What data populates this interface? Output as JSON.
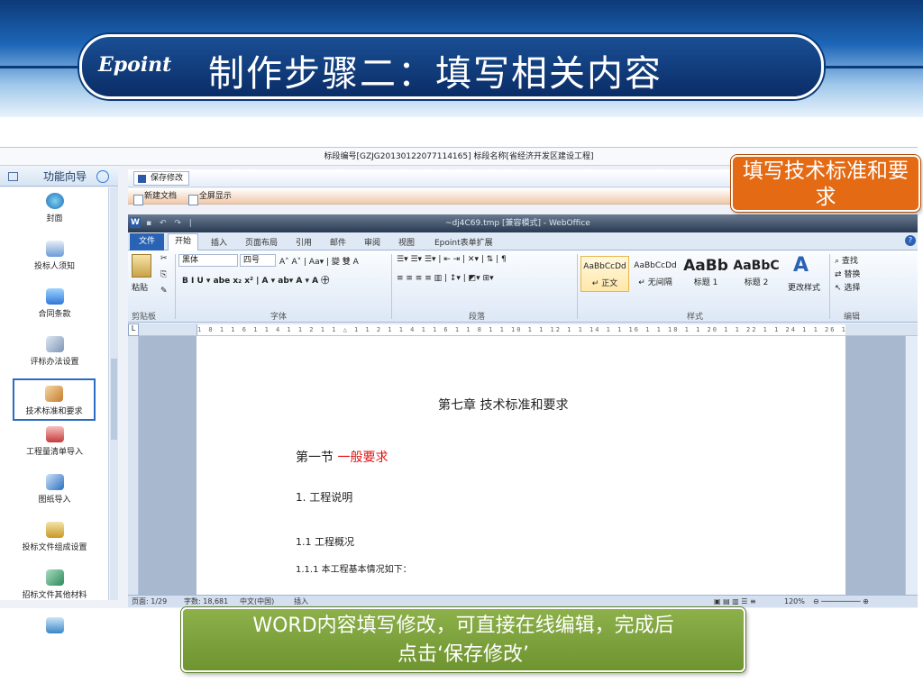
{
  "slide": {
    "logo": "Epoint",
    "title": "制作步骤二：填写相关内容"
  },
  "info_bar": "标段编号[GZJG20130122077114165]  标段名称[省经济开发区建设工程]",
  "sidebar": {
    "title": "功能向导",
    "items": [
      {
        "label": "封面",
        "icon": "globe-icon"
      },
      {
        "label": "投标人须知",
        "icon": "user-doc-icon"
      },
      {
        "label": "合同条款",
        "icon": "contract-icon"
      },
      {
        "label": "评标办法设置",
        "icon": "pen-icon"
      },
      {
        "label": "技术标准和要求",
        "icon": "tools-icon"
      },
      {
        "label": "工程量清单导入",
        "icon": "book-icon"
      },
      {
        "label": "图纸导入",
        "icon": "drawing-icon"
      },
      {
        "label": "投标文件组成设置",
        "icon": "bag-icon"
      },
      {
        "label": "招标文件其他材料",
        "icon": "materials-icon"
      }
    ],
    "selected_index": 4
  },
  "toolbar": {
    "save_label": "保存修改",
    "new_doc_label": "新建文档",
    "fullscreen_label": "全屏显示"
  },
  "office": {
    "title": "~dj4C69.tmp [兼容模式] - WebOffice",
    "tabs": [
      "文件",
      "开始",
      "插入",
      "页面布局",
      "引用",
      "邮件",
      "审阅",
      "视图",
      "Epoint表单扩展"
    ],
    "font_name": "黑体",
    "font_size": "四号",
    "paste_label": "粘贴",
    "group_labels": {
      "clipboard": "剪贴板",
      "font": "字体",
      "paragraph": "段落",
      "styles": "样式",
      "editing": "编辑"
    },
    "styles": [
      {
        "preview": "AaBbCcDd",
        "name": "↵ 正文"
      },
      {
        "preview": "AaBbCcDd",
        "name": "↵ 无间隔"
      },
      {
        "preview": "AaBb",
        "name": "标题 1"
      },
      {
        "preview": "AaBbC",
        "name": "标题 2"
      }
    ],
    "change_styles": "更改样式",
    "find": "查找",
    "replace": "替换",
    "select": "选择"
  },
  "document": {
    "chapter": "第七章   技术标准和要求",
    "section_prefix": "第一节  ",
    "section_highlight": "一般要求",
    "h1": "1. 工程说明",
    "h2": "1.1   工程概况",
    "p1": "1.1.1  本工程基本情况如下：",
    "ruler": "1 8 1  1 6 1  1 4 1  1 2 1  1 △ 1  1 2 1  1 4 1  1 6 1  1 8 1  1 10 1  1 12 1  1 14 1  1 16 1  1 18 1  1 20 1  1 22 1  1 24 1  1 26 1  1 28 1  1 30 1  1 32 1  1 34 1  1 36 1  1 38 1  1 40 1  1 42 1  1 44 1  1 46 1  1 48"
  },
  "status": {
    "page": "页面: 1/29",
    "words": "字数: 18,681",
    "lang": "中文(中国)",
    "mode": "插入",
    "zoom": "120%"
  },
  "callouts": {
    "top": "填写技术标准和要求",
    "bottom_line1": "WORD内容填写修改，可直接在线编辑，完成后",
    "bottom_line2": "点击‘保存修改’"
  },
  "colors": {
    "header_blue": "#0d3a78",
    "callout_orange": "#e46a14",
    "callout_green": "#7a9f3a",
    "highlight_red": "#e01010"
  }
}
